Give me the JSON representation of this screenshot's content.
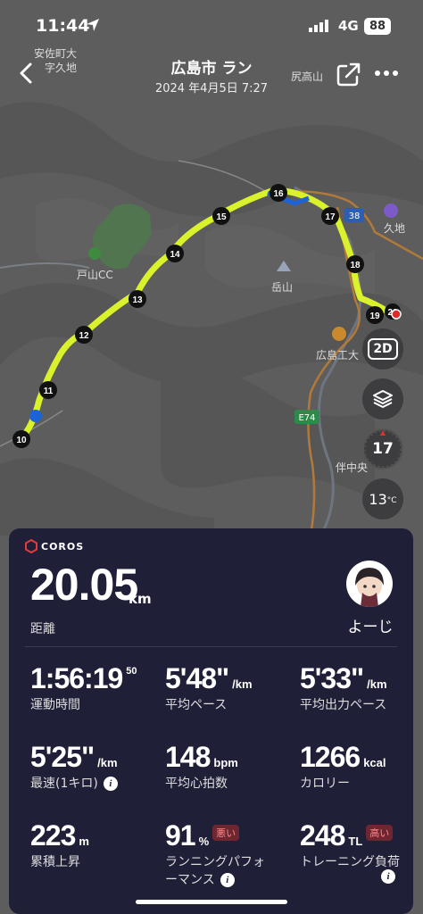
{
  "status": {
    "time": "11:44",
    "network": "4G",
    "battery": "88"
  },
  "header": {
    "title": "広島市 ラン",
    "subtitle": "2024 年4月5日 7:27"
  },
  "map": {
    "place_labels": [
      "安佐町大",
      "字久地",
      "戸山CC",
      "岳山",
      "広島工大",
      "伴中央",
      "尻高山",
      "久地"
    ],
    "road_labels": [
      "38",
      "E74"
    ],
    "km_markers": [
      "10",
      "11",
      "12",
      "13",
      "14",
      "15",
      "16",
      "17",
      "18",
      "19",
      "20"
    ],
    "route_color": "#d9f22b",
    "controls": {
      "view_mode": "2D",
      "compass_value": "17",
      "temperature": "13",
      "temperature_unit": "°C"
    }
  },
  "card": {
    "brand": "COROS",
    "distance": {
      "value": "20.05",
      "unit": "km",
      "label": "距離"
    },
    "user": {
      "name": "よーじ"
    },
    "metrics": [
      {
        "value": "1:56:19",
        "sub": "50",
        "unit": "",
        "label": "運動時間"
      },
      {
        "value": "5'48\"",
        "unit": "/km",
        "label": "平均ペース"
      },
      {
        "value": "5'33\"",
        "unit": "/km",
        "label": "平均出力ペース"
      },
      {
        "value": "5'25\"",
        "unit": "/km",
        "label": "最速(1キロ)"
      },
      {
        "value": "148",
        "unit": "bpm",
        "label": "平均心拍数"
      },
      {
        "value": "1266",
        "unit": "kcal",
        "label": "カロリー"
      },
      {
        "value": "223",
        "unit": "m",
        "label": "累積上昇"
      },
      {
        "value": "91",
        "unit": "%",
        "badge": "悪い",
        "label": "ランニングパフォーマンス"
      },
      {
        "value": "248",
        "unit": "TL",
        "badge": "高い",
        "label": "トレーニング負荷"
      }
    ]
  }
}
